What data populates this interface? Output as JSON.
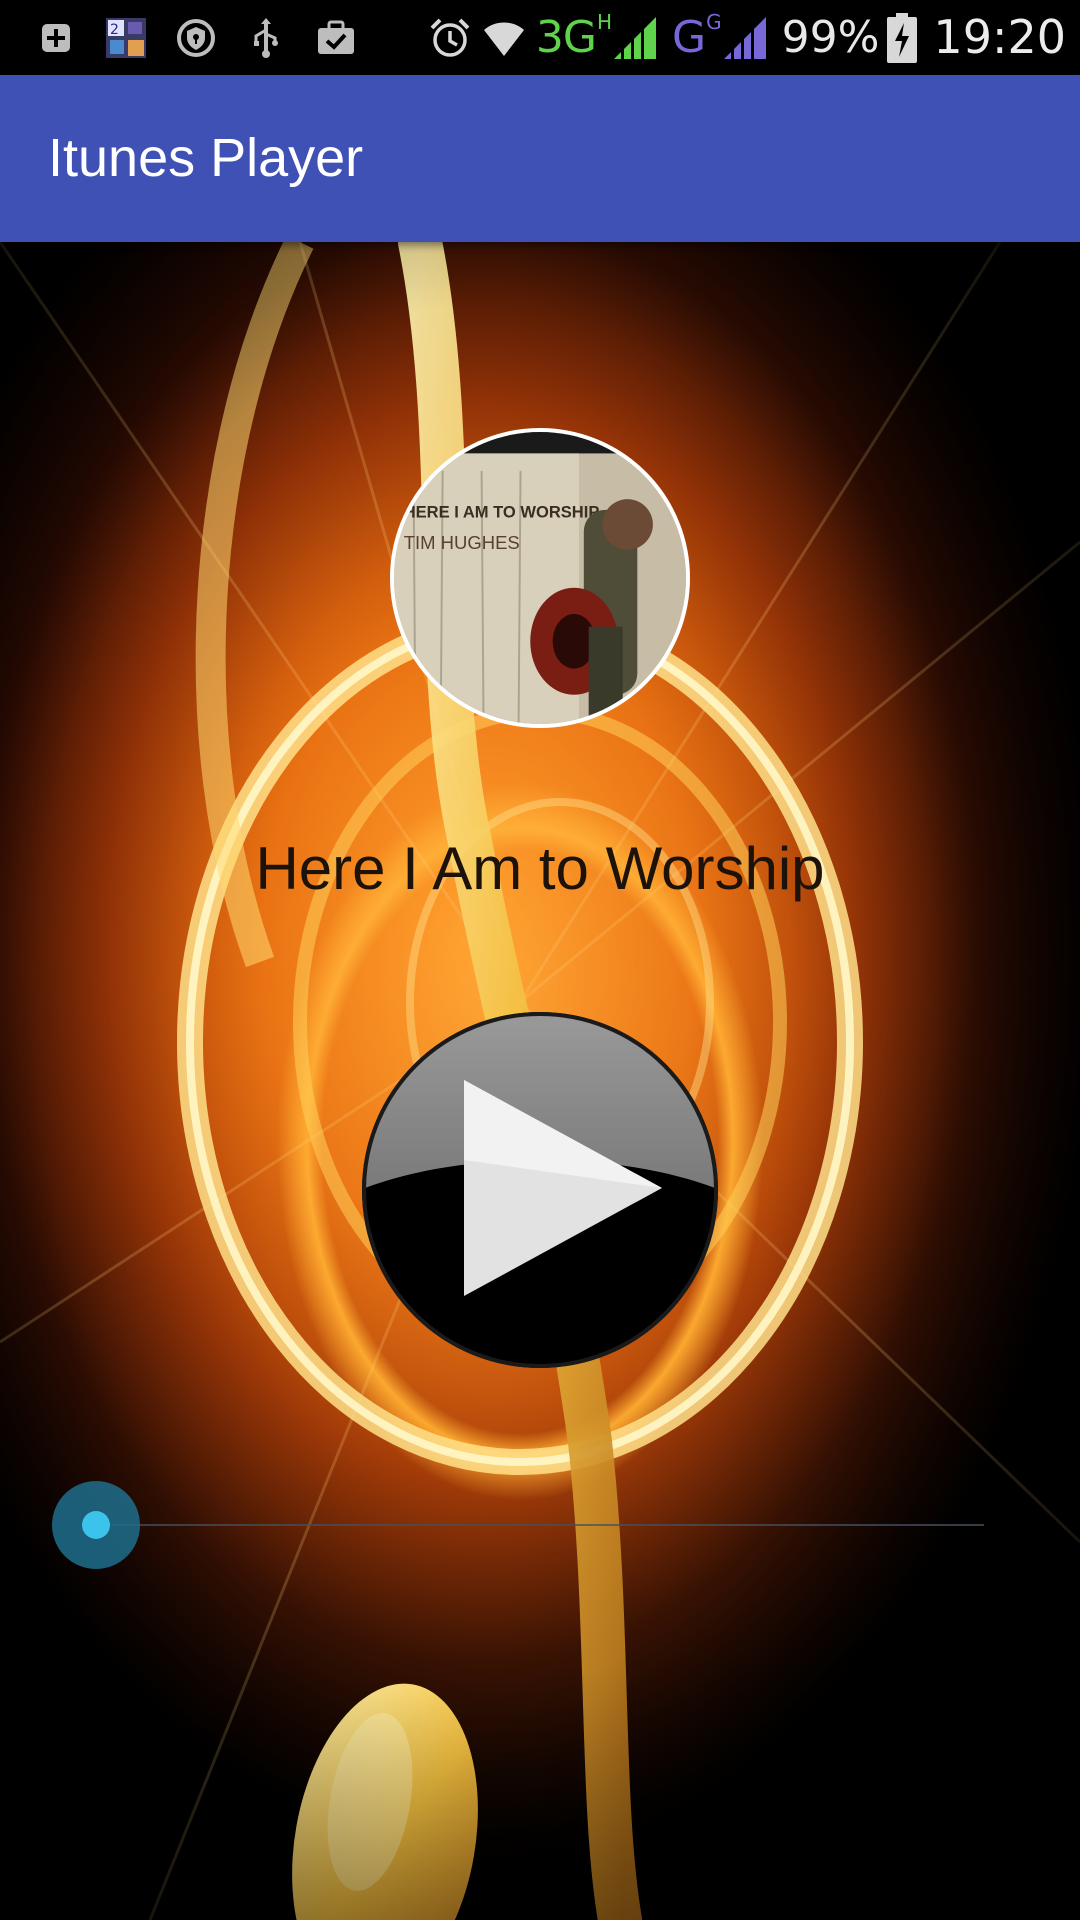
{
  "status_bar": {
    "icons_left": [
      "add-box-icon",
      "game-notification-icon",
      "shield-icon",
      "usb-icon",
      "briefcase-check-icon"
    ],
    "icons_right": [
      "alarm-icon",
      "wifi-icon"
    ],
    "network_primary": "3G",
    "network_primary_sup": "H",
    "network_secondary": "G",
    "network_secondary_sup": "G",
    "battery_percent": "99%",
    "battery_state": "charging",
    "time": "19:20",
    "colors": {
      "network_3g": "#5fd34b",
      "network_g": "#7768d8"
    }
  },
  "app_bar": {
    "title": "Itunes Player",
    "color": "#3f51b5"
  },
  "player": {
    "album_cover_text": "HERE I AM TO WORSHIP",
    "album_artist_text": "TIM HUGHES",
    "song_title": "Here I Am to Worship",
    "play_button_icon": "play-icon",
    "seek": {
      "progress": 0,
      "accent_color": "#33b5e5"
    }
  }
}
